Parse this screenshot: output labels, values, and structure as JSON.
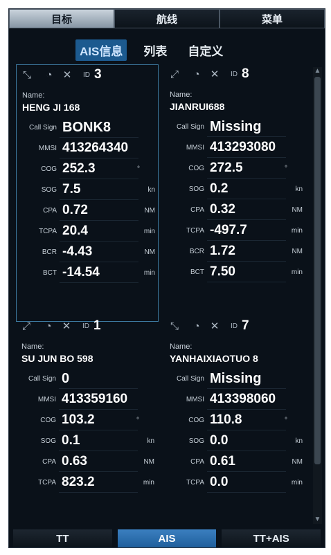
{
  "top_tabs": [
    {
      "label": "目标",
      "active": true
    },
    {
      "label": "航线",
      "active": false
    },
    {
      "label": "菜单",
      "active": false
    }
  ],
  "sub_tabs": [
    {
      "label": "AIS信息",
      "active": true
    },
    {
      "label": "列表",
      "active": false
    },
    {
      "label": "自定义",
      "active": false
    }
  ],
  "id_prefix": "ID",
  "name_label": "Name:",
  "row_labels": {
    "call_sign": "Call Sign",
    "mmsi": "MMSI",
    "cog": "COG",
    "sog": "SOG",
    "cpa": "CPA",
    "tcpa": "TCPA",
    "bcr": "BCR",
    "bct": "BCT"
  },
  "units": {
    "cog": "°",
    "sog": "kn",
    "cpa": "NM",
    "tcpa": "min",
    "bcr": "NM",
    "bct": "min"
  },
  "targets": [
    {
      "id": "3",
      "name": "HENG JI 168",
      "call_sign": "BONK8",
      "mmsi": "413264340",
      "cog": "252.3",
      "sog": "7.5",
      "cpa": "0.72",
      "tcpa": "20.4",
      "bcr": "-4.43",
      "bct": "-14.54"
    },
    {
      "id": "8",
      "name": "JIANRUI688",
      "call_sign": "Missing",
      "mmsi": "413293080",
      "cog": "272.5",
      "sog": "0.2",
      "cpa": "0.32",
      "tcpa": "-497.7",
      "bcr": "1.72",
      "bct": "7.50"
    },
    {
      "id": "1",
      "name": "SU JUN BO 598",
      "call_sign": "0",
      "mmsi": "413359160",
      "cog": "103.2",
      "sog": "0.1",
      "cpa": "0.63",
      "tcpa": "823.2"
    },
    {
      "id": "7",
      "name": "YANHAIXIAOTUO 8",
      "call_sign": "Missing",
      "mmsi": "413398060",
      "cog": "110.8",
      "sog": "0.0",
      "cpa": "0.61",
      "tcpa": "0.0"
    }
  ],
  "icons": {
    "collapse": "collapse-arrows-icon",
    "expand": "expand-arrows-icon",
    "track": "track-circle-icon",
    "close": "close-icon"
  },
  "bottom_tabs": [
    {
      "label": "TT",
      "active": false
    },
    {
      "label": "AIS",
      "active": true
    },
    {
      "label": "TT+AIS",
      "active": false
    }
  ],
  "colors": {
    "background": "#0a1119",
    "active_tab": "#1f5f9c",
    "selected_border": "#3d7aa0",
    "text": "#ffffff"
  }
}
